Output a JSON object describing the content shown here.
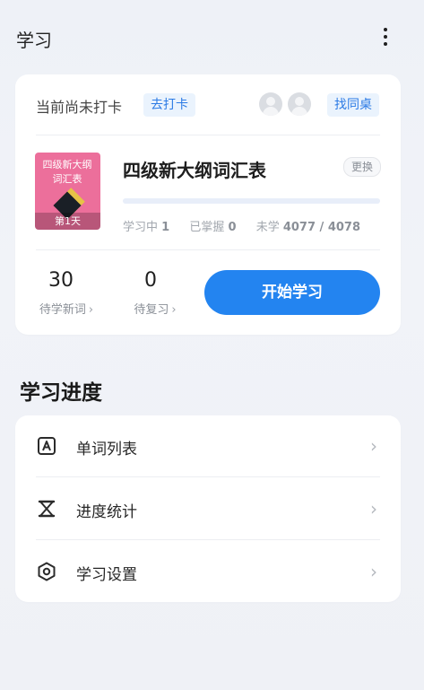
{
  "header": {
    "title": "学习",
    "more_icon": "more-vert-icon"
  },
  "today": {
    "status_text": "当前尚未打卡",
    "clock_in_label": "去打卡",
    "find_deskmate_label": "找同桌",
    "avatar_icons": [
      "user-avatar-icon",
      "user-avatar-icon"
    ]
  },
  "book": {
    "cover_title": "四级新大纲词汇表",
    "cover_day": "第1天",
    "title": "四级新大纲词汇表",
    "change_label": "更换",
    "progress_fraction": 0.0002,
    "stats": {
      "learning_label": "学习中",
      "learning_value": "1",
      "mastered_label": "已掌握",
      "mastered_value": "0",
      "unlearned_label": "未学",
      "unlearned_value": "4077 / 4078"
    }
  },
  "counts": {
    "new_words_value": "30",
    "new_words_label": "待学新词",
    "review_value": "0",
    "review_label": "待复习"
  },
  "start_button_label": "开始学习",
  "progress_section": {
    "title": "学习进度",
    "items": [
      {
        "label": "单词列表",
        "icon": "word-list-icon"
      },
      {
        "label": "进度统计",
        "icon": "progress-stats-icon"
      },
      {
        "label": "学习设置",
        "icon": "settings-icon"
      }
    ]
  },
  "colors": {
    "accent": "#2384f0",
    "chip_bg": "#eaf3fd",
    "cover": "#ec6f9b"
  }
}
